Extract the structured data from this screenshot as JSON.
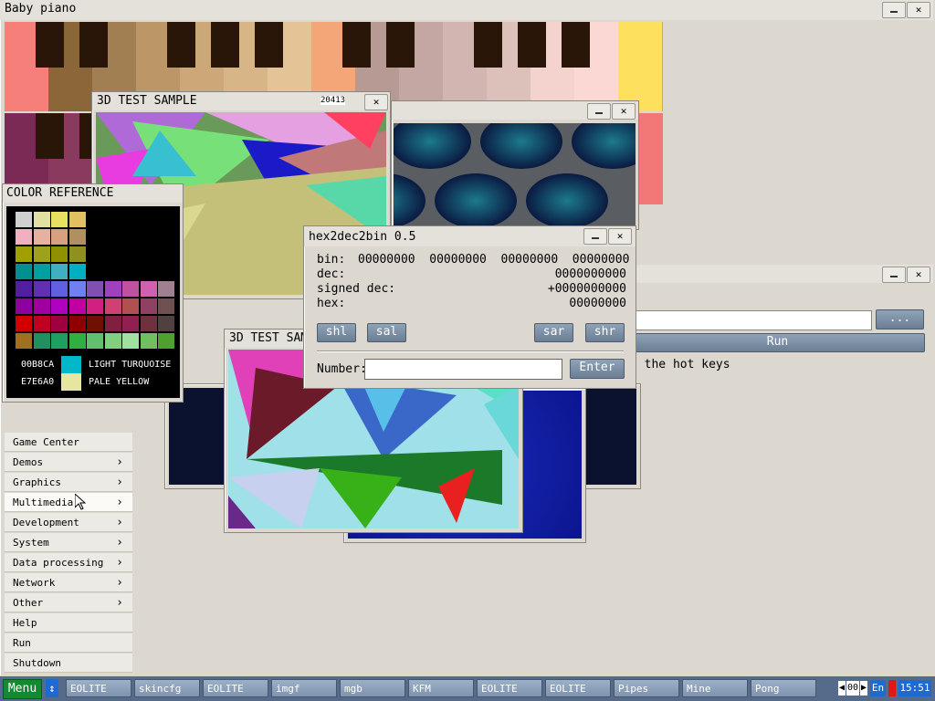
{
  "baby_piano": {
    "title": "Baby piano"
  },
  "test3d_1": {
    "title": "3D TEST SAMPLE",
    "fps": "20413"
  },
  "test3d_2": {
    "title": "3D TEST SAMPLE"
  },
  "color_ref": {
    "title": "COLOR REFERENCE",
    "selected": [
      {
        "hex": "00B8CA",
        "name": "LIGHT TURQUOISE",
        "color": "#00b8ca"
      },
      {
        "hex": "E7E6A0",
        "name": "PALE YELLOW",
        "color": "#e7e6a0"
      }
    ]
  },
  "hex2dec": {
    "title": "hex2dec2bin 0.5",
    "bin_label": "bin:",
    "bin_value": "00000000  00000000  00000000  00000000",
    "dec_label": "dec:",
    "dec_value": "0000000000",
    "sdec_label": "signed dec:",
    "sdec_value": "+0000000000",
    "hex_label": "hex:",
    "hex_value": "00000000",
    "buttons": {
      "shl": "shl",
      "sal": "sal",
      "sar": "sar",
      "shr": "shr"
    },
    "number_label": "Number:",
    "enter_label": "Enter"
  },
  "run_dialog": {
    "browse_label": "...",
    "run_label": "Run",
    "hint": "t the hot keys"
  },
  "menu": {
    "items": [
      {
        "label": "Game Center",
        "sub": false
      },
      {
        "label": "Demos",
        "sub": true
      },
      {
        "label": "Graphics",
        "sub": true
      },
      {
        "label": "Multimedia",
        "sub": true
      },
      {
        "label": "Development",
        "sub": true
      },
      {
        "label": "System",
        "sub": true
      },
      {
        "label": "Data processing",
        "sub": true
      },
      {
        "label": "Network",
        "sub": true
      },
      {
        "label": "Other",
        "sub": true
      },
      {
        "label": "Help",
        "sub": false
      },
      {
        "label": "Run",
        "sub": false
      },
      {
        "label": "Shutdown",
        "sub": false
      }
    ]
  },
  "taskbar": {
    "menu_label": "Menu",
    "tasks": [
      "EOLITE",
      "skincfg",
      "EOLITE",
      "imgf",
      "mgb",
      "KFM",
      "EOLITE",
      "EOLITE",
      "Pipes",
      "Mine",
      "Pong"
    ],
    "desktop_num": "00",
    "lang": "En",
    "clock": "15:51"
  }
}
